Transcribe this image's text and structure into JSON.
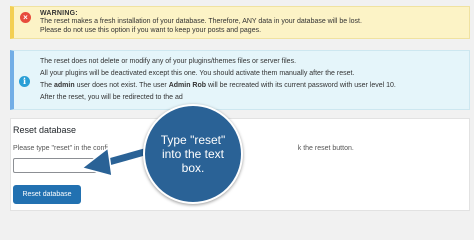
{
  "warning": {
    "title": "WARNING:",
    "line1": "The reset makes a fresh installation of your database. Therefore, ANY data in your database will be lost.",
    "line2": "Please do not use this option if you want to keep your posts and pages.",
    "icon": "close-icon",
    "color": "#f3cf52"
  },
  "info": {
    "icon": "info-icon",
    "line1": "The reset does not delete or modify any of your plugins/themes files or server files.",
    "line2": "All your plugins will be deactivated except this one. You should activate them manually after the reset.",
    "line3_pre": "The ",
    "line3_bold1": "admin",
    "line3_mid": " user does not exist. The user ",
    "line3_bold2": "Admin Rob",
    "line3_post": " will be recreated with its current password with user level 10.",
    "line4": "After the reset, you will be redirected to the ad",
    "color": "#72aee6"
  },
  "reset": {
    "title": "Reset database",
    "prompt_pre": "Please type \"reset\" in the confi",
    "prompt_post": "k the reset button.",
    "input_value": "",
    "button_label": "Reset database",
    "button_color": "#2271b1"
  },
  "callout": {
    "text": "Type \"reset\" into the text box.",
    "color": "#2a6296"
  }
}
